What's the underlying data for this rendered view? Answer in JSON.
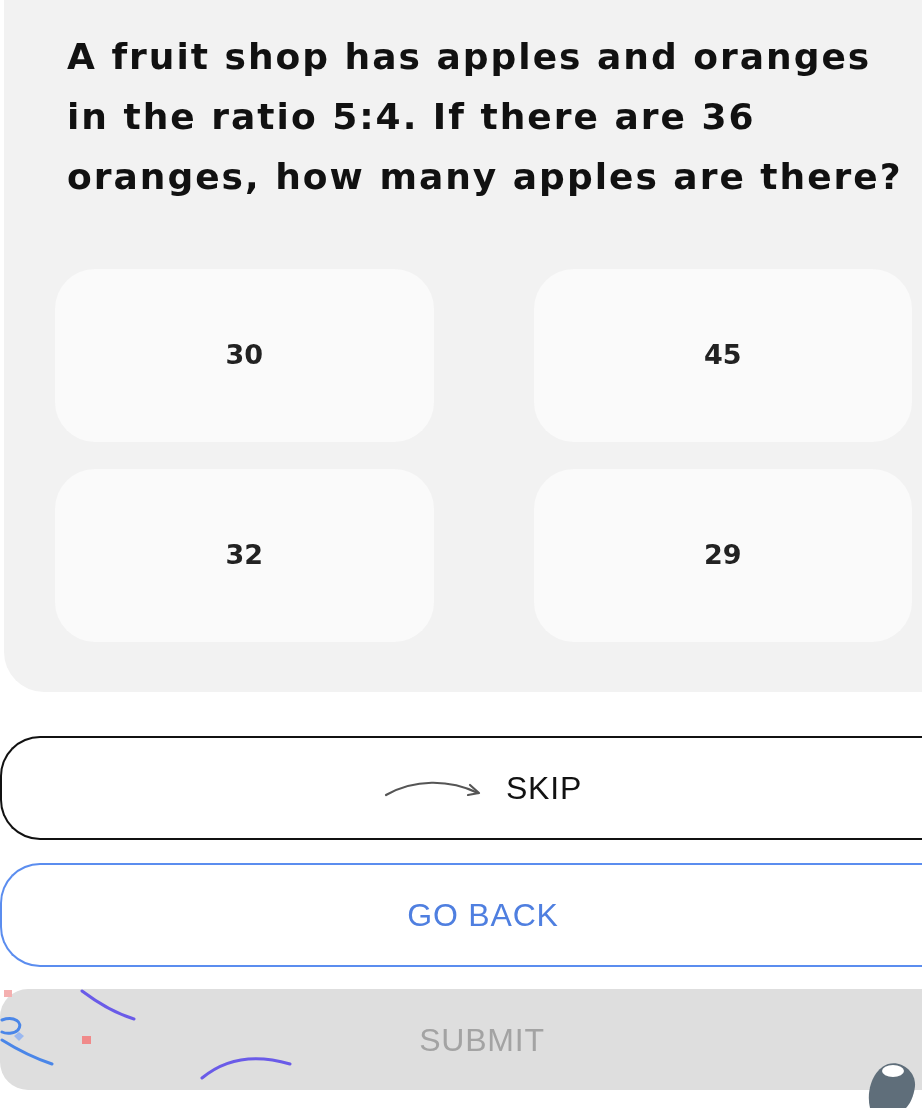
{
  "question": "A fruit shop has apples and oranges in the ratio 5:4. If there are 36 oranges, how many apples are there?",
  "options": [
    {
      "label": "30",
      "selected": false
    },
    {
      "label": "45",
      "selected": false
    },
    {
      "label": "32",
      "selected": false
    },
    {
      "label": "29",
      "selected": false
    }
  ],
  "buttons": [
    {
      "kind": "skip",
      "label": "SKIP",
      "disabled": false
    },
    {
      "kind": "back",
      "label": "GO BACK",
      "disabled": false
    },
    {
      "kind": "submit",
      "label": "SUBMIT",
      "disabled": true
    }
  ]
}
